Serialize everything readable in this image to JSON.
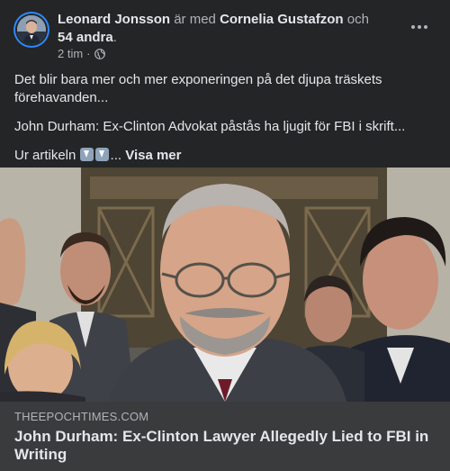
{
  "post": {
    "author": "Leonard Jonsson",
    "with_text": " är med ",
    "tagged": "Cornelia Gustafzon",
    "and_text": " och",
    "others": "54 andra",
    "others_suffix": ".",
    "time": "2 tim",
    "separator": "·",
    "privacy_icon": "globe-icon",
    "paragraphs": [
      "Det blir bara mer och mer exponeringen på det djupa träskets förehavanden...",
      "John Durham: Ex-Clinton Advokat påstås ha ljugit för FBI i skrift..."
    ],
    "source_prefix": "Ur artikeln",
    "emoji": [
      "down-arrow-emoji",
      "down-arrow-emoji"
    ],
    "ellipsis": "...",
    "see_more": "Visa mer"
  },
  "link": {
    "domain": "THEEPOCHTIMES.COM",
    "title": "John Durham: Ex-Clinton Lawyer Allegedly Lied to FBI in Writing"
  },
  "colors": {
    "background": "#242526",
    "link_preview_bg": "#3a3b3c",
    "primary_text": "#e4e6eb",
    "secondary_text": "#b0b3b8",
    "avatar_ring": "#2d88ff"
  }
}
